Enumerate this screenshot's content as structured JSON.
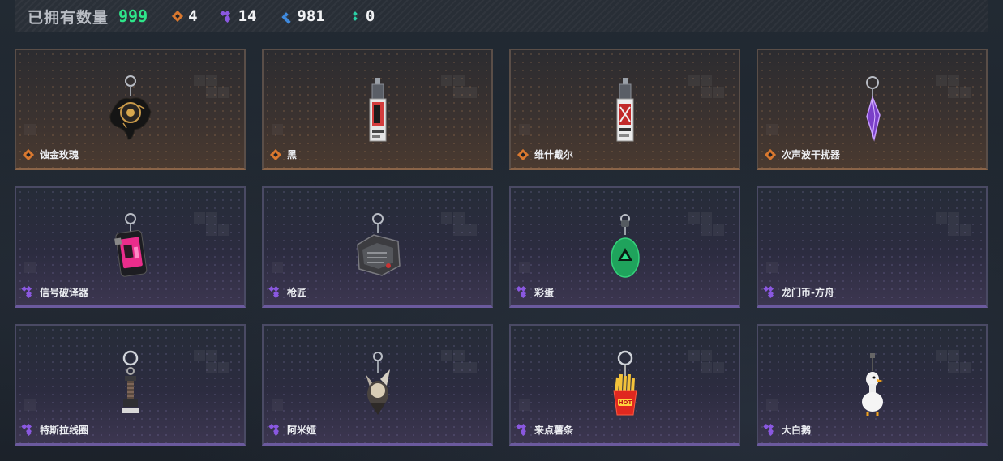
{
  "header": {
    "owned_label": "已拥有数量",
    "owned_count": "999",
    "stats": [
      {
        "rarity": "orange",
        "icon": "orange-diamond-icon",
        "value": "4"
      },
      {
        "rarity": "purple",
        "icon": "purple-cluster-icon",
        "value": "14"
      },
      {
        "rarity": "blue",
        "icon": "blue-cluster-icon",
        "value": "981"
      },
      {
        "rarity": "green",
        "icon": "green-dots-icon",
        "value": "0"
      }
    ]
  },
  "colors": {
    "owned_count": "#2ee58a",
    "orange": "#d9782f",
    "purple": "#8a58e0",
    "blue": "#3f8be0",
    "green": "#2bd0a6"
  },
  "items": [
    {
      "name": "蚀金玫瑰",
      "rarity": "orange",
      "icon": "black-rose-charm-icon"
    },
    {
      "name": "黑",
      "rarity": "orange",
      "icon": "phone-card-charm-icon"
    },
    {
      "name": "维什戴尔",
      "rarity": "orange",
      "icon": "phone-card-charm-icon"
    },
    {
      "name": "次声波干扰器",
      "rarity": "orange",
      "icon": "purple-crystal-charm-icon"
    },
    {
      "name": "信号破译器",
      "rarity": "purple",
      "icon": "pink-device-charm-icon"
    },
    {
      "name": "枪匠",
      "rarity": "purple",
      "icon": "gun-box-charm-icon"
    },
    {
      "name": "彩蛋",
      "rarity": "purple",
      "icon": "green-egg-charm-icon"
    },
    {
      "name": "龙门币-方舟",
      "rarity": "purple",
      "icon": "empty-slot-icon"
    },
    {
      "name": "特斯拉线圈",
      "rarity": "purple",
      "icon": "tesla-coil-charm-icon"
    },
    {
      "name": "阿米娅",
      "rarity": "purple",
      "icon": "amiya-charm-icon"
    },
    {
      "name": "来点薯条",
      "rarity": "purple",
      "icon": "fries-charm-icon"
    },
    {
      "name": "大白鹅",
      "rarity": "purple",
      "icon": "white-goose-charm-icon"
    }
  ]
}
